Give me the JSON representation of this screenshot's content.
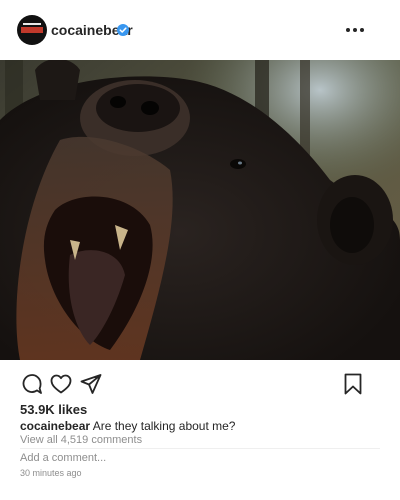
{
  "post": {
    "username": "cocainebear",
    "verified": true,
    "likes": "53.9K likes",
    "caption_user": "cocainebear",
    "caption_text": "Are they talking about me?",
    "view_comments": "View all 4,519 comments",
    "add_comment_placeholder": "Add a comment...",
    "timestamp": "30 minutes ago"
  },
  "icons": {
    "verified": "verified-badge-icon",
    "more": "more-options-icon",
    "comment": "comment-icon",
    "like": "heart-icon",
    "share": "send-icon",
    "save": "bookmark-icon"
  },
  "colors": {
    "verified_blue": "#3897f0",
    "text": "#262626",
    "muted": "#8e8e8e"
  }
}
